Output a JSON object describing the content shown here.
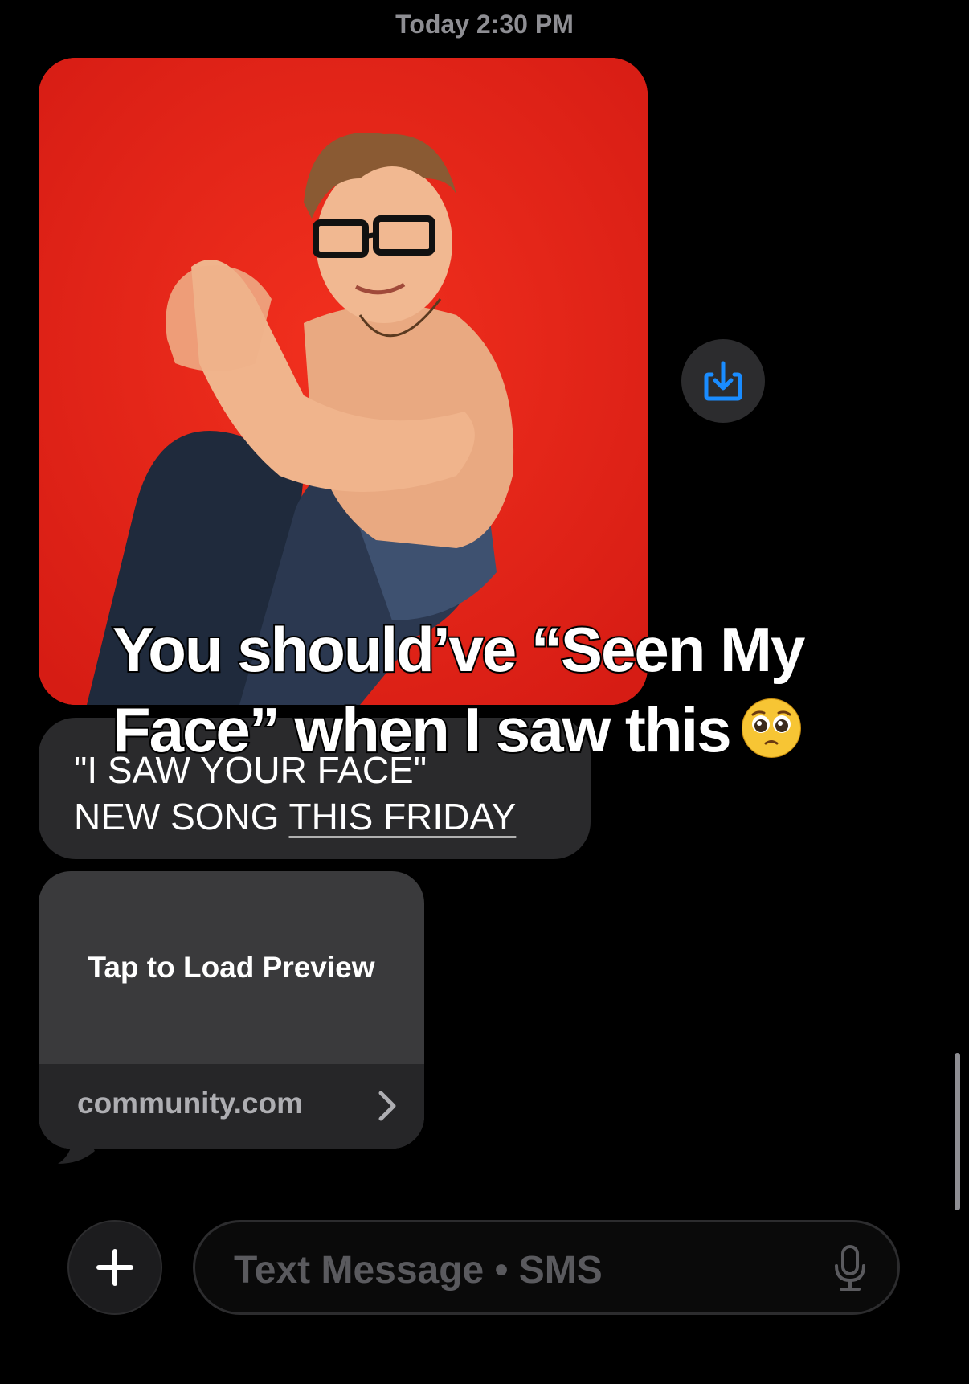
{
  "timestamp": {
    "day": "Today",
    "time": "2:30 PM"
  },
  "photo": {
    "alt_icon": "photo-attachment"
  },
  "save_button": {
    "icon": "download-icon",
    "color": "#1a8cff"
  },
  "message": {
    "line1": "\"I SAW YOUR FACE\"",
    "line2_prefix": "NEW SONG ",
    "line2_link": "THIS FRIDAY"
  },
  "link_preview": {
    "label": "Tap to Load Preview",
    "domain": "community.com"
  },
  "caption": {
    "line1": "You should’ve “Seen My",
    "line2": "Face” when I saw this"
  },
  "composer": {
    "placeholder": "Text Message • SMS",
    "plus_icon": "plus-icon",
    "mic_icon": "microphone-icon"
  },
  "colors": {
    "background": "#000000",
    "bubble": "#2a2a2c",
    "photo_red": "#e8231a",
    "accent_blue": "#1a8cff"
  }
}
